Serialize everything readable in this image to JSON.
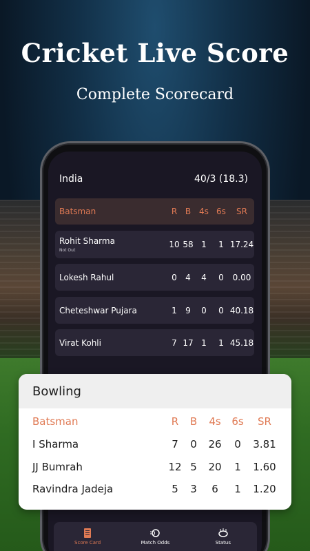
{
  "hero": {
    "title": "Cricket Live Score",
    "subtitle": "Complete Scorecard"
  },
  "scorecard": {
    "team": "India",
    "score": "40/3 (18.3)",
    "header": {
      "name": "Batsman",
      "r": "R",
      "b": "B",
      "fours": "4s",
      "sixes": "6s",
      "sr": "SR"
    },
    "batsmen": [
      {
        "name": "Rohit Sharma",
        "status": "Not Out",
        "r": "10",
        "b": "58",
        "fours": "1",
        "sixes": "1",
        "sr": "17.24"
      },
      {
        "name": "Lokesh Rahul",
        "status": "",
        "r": "0",
        "b": "4",
        "fours": "4",
        "sixes": "0",
        "sr": "0.00"
      },
      {
        "name": "Cheteshwar Pujara",
        "status": "",
        "r": "1",
        "b": "9",
        "fours": "0",
        "sixes": "0",
        "sr": "40.18"
      },
      {
        "name": "Virat Kohli",
        "status": "",
        "r": "7",
        "b": "17",
        "fours": "1",
        "sixes": "1",
        "sr": "45.18"
      }
    ]
  },
  "bowling": {
    "title": "Bowling",
    "header": {
      "name": "Batsman",
      "r": "R",
      "b": "B",
      "fours": "4s",
      "sixes": "6s",
      "sr": "SR"
    },
    "rows": [
      {
        "name": "I Sharma",
        "r": "7",
        "b": "0",
        "fours": "26",
        "sixes": "0",
        "sr": "3.81"
      },
      {
        "name": "JJ Bumrah",
        "r": "12",
        "b": "5",
        "fours": "20",
        "sixes": "1",
        "sr": "1.60"
      },
      {
        "name": "Ravindra Jadeja",
        "r": "5",
        "b": "3",
        "fours": "6",
        "sixes": "1",
        "sr": "1.20"
      }
    ]
  },
  "nav": {
    "items": [
      {
        "label": "Score Card",
        "icon": "scorecard-icon",
        "active": true
      },
      {
        "label": "Match Odds",
        "icon": "ball-icon",
        "active": false
      },
      {
        "label": "Status",
        "icon": "stadium-icon",
        "active": false
      }
    ]
  },
  "colors": {
    "accent": "#e07a54",
    "card": "#2a2636",
    "screen": "#1a1724"
  }
}
